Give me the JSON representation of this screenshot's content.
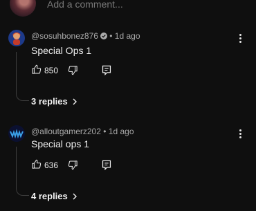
{
  "add_comment": {
    "placeholder": "Add a comment..."
  },
  "comments": [
    {
      "handle": "@sosuhbonez876",
      "age": "• 1d ago",
      "text": "Special Ops 1",
      "likes": "850",
      "replies_label": "3 replies"
    },
    {
      "handle": "@alloutgamerz202",
      "age": "• 1d ago",
      "text": "Special ops 1",
      "likes": "636",
      "replies_label": "4 replies"
    }
  ],
  "icons": [
    "thumb-up-icon",
    "thumb-down-icon",
    "reply-icon",
    "more-vert-icon",
    "verified-icon",
    "chevron-right-icon"
  ],
  "colors": {
    "background": "#0f0f0f",
    "text": "#f1f1f1",
    "muted": "#aaaaaa",
    "thread": "#3d3d3d"
  }
}
